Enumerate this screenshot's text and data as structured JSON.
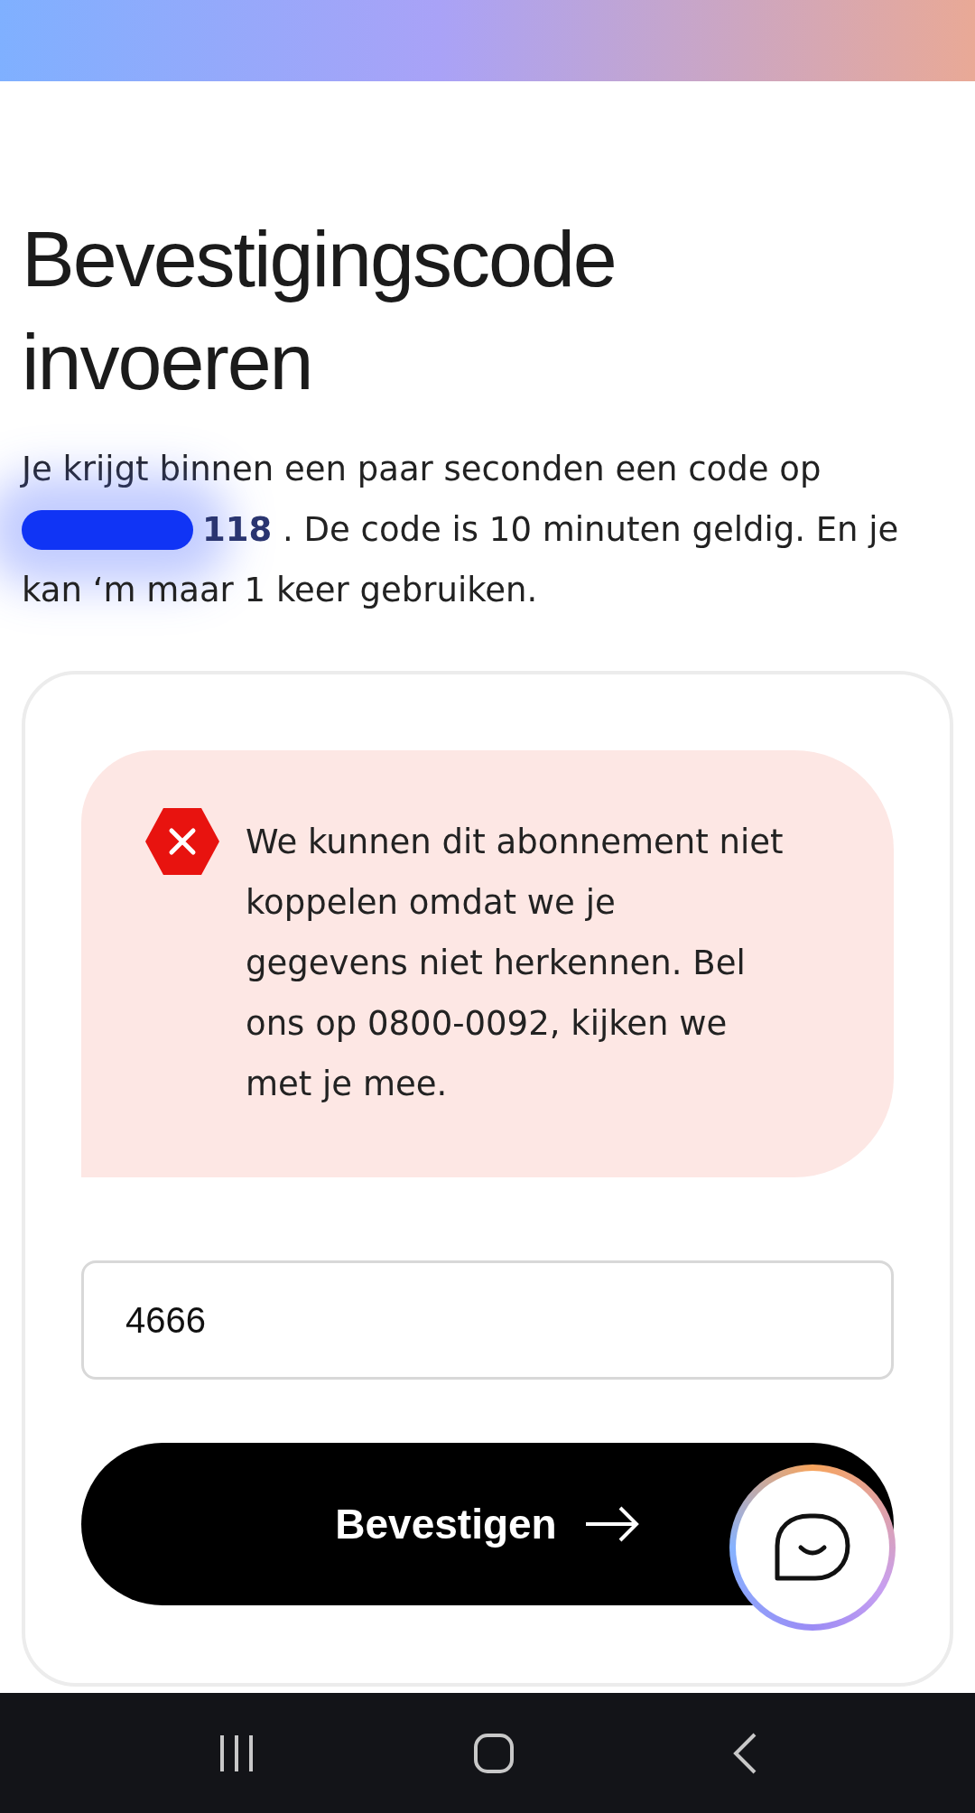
{
  "title": "Bevestigingscode invoeren",
  "intro_lines": [
    "Je krijgt binnen een paar seconden een code op",
    "**118** . De code is 10 minuten geldig. En je",
    "kan ‘m maar 1 keer gebruiken."
  ],
  "alert": {
    "kind": "error",
    "message": "We kunnen dit abonnement niet koppelen omdat we je gegevens niet herkennen. Bel ons op 0800-0092, kijken we met je mee."
  },
  "code_field": {
    "value": "4666"
  },
  "submit_button": {
    "label": "Bevestigen"
  }
}
